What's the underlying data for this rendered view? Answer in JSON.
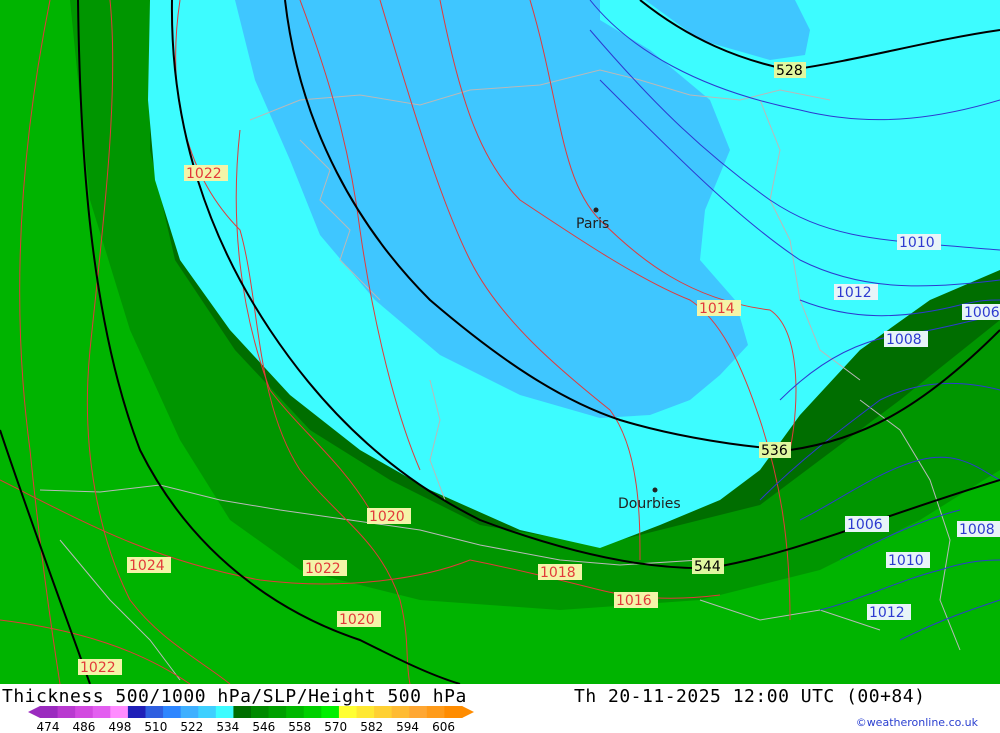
{
  "map": {
    "colors": {
      "thick_528": "#3fc6ff",
      "thick_534": "#3dfcff",
      "thick_540": "#006e00",
      "thick_546": "#009600",
      "thick_552": "#00b400",
      "slp_red": "#e23a3a",
      "slp_blue": "#2d3ad0",
      "height_line": "#000000",
      "border": "#b9b9b9"
    },
    "height_labels": [
      "528",
      "536",
      "544"
    ],
    "slp_labels_red": [
      "1022",
      "1014",
      "1020",
      "1022",
      "1024",
      "1018",
      "1016",
      "1020",
      "1022"
    ],
    "slp_labels_blue": [
      "1010",
      "1012",
      "1008",
      "1006",
      "1006",
      "1010",
      "1012",
      "1008"
    ],
    "cities": [
      {
        "name": "Paris"
      },
      {
        "name": "Dourbies"
      }
    ]
  },
  "footer": {
    "title_left": "Thickness 500/1000 hPa/SLP/Height 500 hPa",
    "title_right": "Th 20-11-2025 12:00 UTC (00+84)",
    "credit": "©weatheronline.co.uk",
    "legend": {
      "ticks": [
        "474",
        "486",
        "498",
        "510",
        "522",
        "534",
        "546",
        "558",
        "570",
        "582",
        "594",
        "606"
      ],
      "colors": [
        "#9b2bbf",
        "#b93ad0",
        "#d24ae0",
        "#e35ff0",
        "#ff8cff",
        "#1f1fb8",
        "#2f5fe0",
        "#2e86ff",
        "#3fb0ff",
        "#3fd0ff",
        "#3dfcff",
        "#006e00",
        "#008a00",
        "#00a000",
        "#00b800",
        "#00d000",
        "#00f000",
        "#ffff33",
        "#ffe833",
        "#ffd033",
        "#ffbb33",
        "#ffa733",
        "#ff9b1a",
        "#ff8c00"
      ]
    }
  }
}
